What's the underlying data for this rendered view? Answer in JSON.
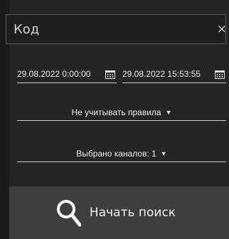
{
  "code_input": {
    "placeholder": "Код",
    "value": ""
  },
  "clear_icon": "×",
  "date_from": {
    "value": "29.08.2022 0:00:00"
  },
  "date_to": {
    "value": "29.08.2022 15:53:55"
  },
  "rules_select": {
    "value": "Не учитывать правила"
  },
  "channels_select": {
    "value": "Выбрано каналов: 1"
  },
  "search_button": {
    "label": "Начать поиск"
  },
  "colors": {
    "background": "#1b1b1b",
    "panel": "#252525",
    "button": "#3e3e3e",
    "text": "#e8e8e8"
  }
}
